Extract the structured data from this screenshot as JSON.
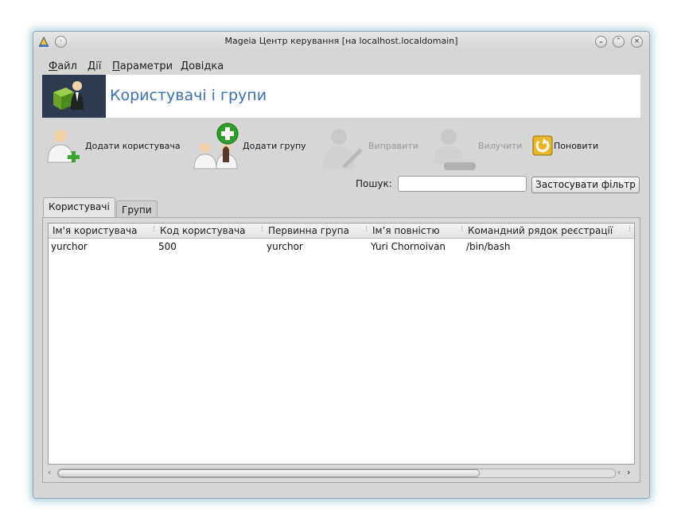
{
  "window": {
    "title": "Mageia Центр керування  [на localhost.localdomain]"
  },
  "menu": {
    "items": [
      "Файл",
      "Дії",
      "Параметри",
      "Довідка"
    ]
  },
  "banner": {
    "title": "Користувачі і групи"
  },
  "toolbar": {
    "add_user": "Додати користувача",
    "add_group": "Додати групу",
    "edit": "Виправити",
    "delete": "Вилучити",
    "refresh": "Поновити"
  },
  "search": {
    "label": "Пошук:",
    "value": "",
    "apply_label": "Застосувати фільтр"
  },
  "tabs": [
    "Користувачі",
    "Групи"
  ],
  "users_table": {
    "columns": [
      "Ім'я користувача",
      "Код користувача",
      "Первинна група",
      "Ім’я повністю",
      "Командний рядок реєстрації"
    ],
    "rows": [
      [
        "yurchor",
        "500",
        "yurchor",
        "Yuri Chornoivan",
        "/bin/bash"
      ]
    ]
  },
  "colors": {
    "banner_title": "#3d6fb0",
    "window_bg": "#d6d6d6"
  }
}
